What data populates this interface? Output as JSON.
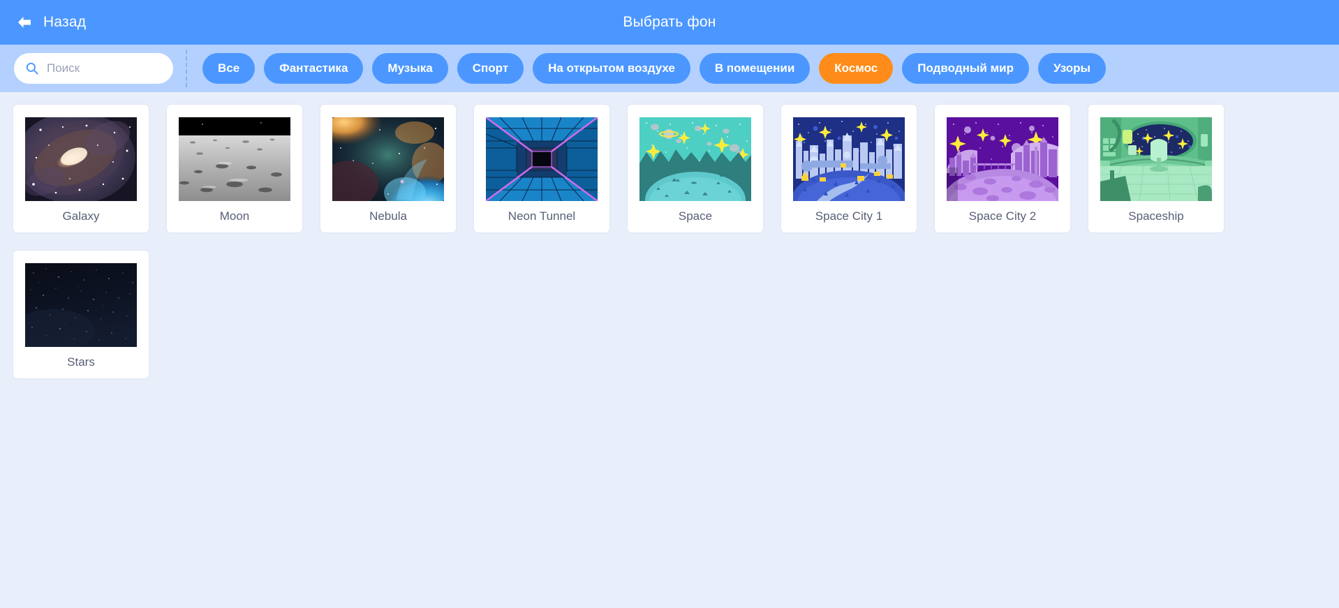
{
  "header": {
    "back_label": "Назад",
    "title": "Выбрать фон",
    "back_icon": "arrow-left-icon",
    "bg_color": "#4c97ff"
  },
  "filters": {
    "search": {
      "placeholder": "Поиск",
      "value": "",
      "icon": "search-icon"
    },
    "tags": [
      {
        "label": "Все",
        "active": false
      },
      {
        "label": "Фантастика",
        "active": false
      },
      {
        "label": "Музыка",
        "active": false
      },
      {
        "label": "Спорт",
        "active": false
      },
      {
        "label": "На открытом воздухе",
        "active": false
      },
      {
        "label": "В помещении",
        "active": false
      },
      {
        "label": "Космос",
        "active": true
      },
      {
        "label": "Подводный мир",
        "active": false
      },
      {
        "label": "Узоры",
        "active": false
      }
    ],
    "active_tag": "Космос",
    "active_color": "#ff8c1a",
    "tag_color": "#4c97ff",
    "bar_bg": "#b3d0ff"
  },
  "gallery": {
    "background": "#e9effa",
    "count": 9,
    "items": [
      {
        "name": "Galaxy",
        "thumb": "galaxy-photo"
      },
      {
        "name": "Moon",
        "thumb": "moon-photo"
      },
      {
        "name": "Nebula",
        "thumb": "nebula-photo"
      },
      {
        "name": "Neon Tunnel",
        "thumb": "neon-tunnel-art"
      },
      {
        "name": "Space",
        "thumb": "space-landscape-art"
      },
      {
        "name": "Space City 1",
        "thumb": "space-city-1-art"
      },
      {
        "name": "Space City 2",
        "thumb": "space-city-2-art"
      },
      {
        "name": "Spaceship",
        "thumb": "spaceship-interior-art"
      },
      {
        "name": "Stars",
        "thumb": "stars-photo"
      }
    ]
  }
}
